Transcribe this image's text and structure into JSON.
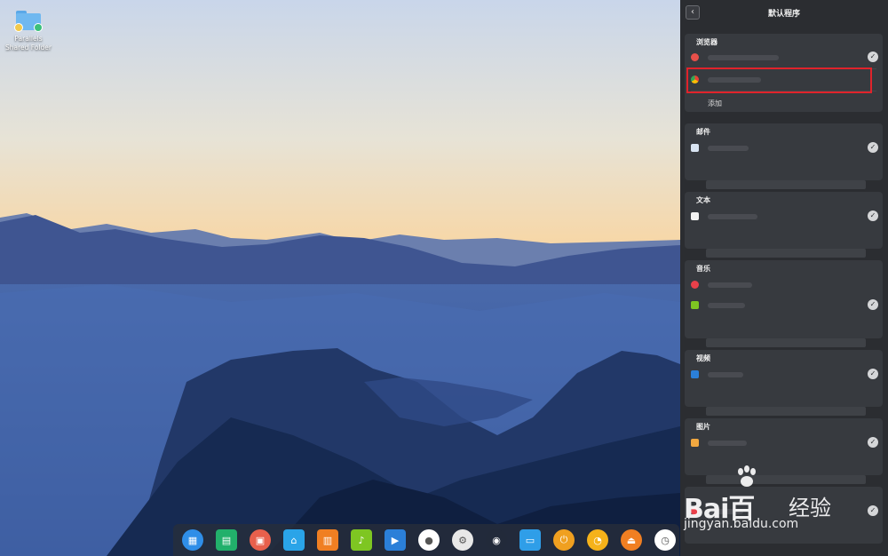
{
  "desktop": {
    "icons": [
      {
        "label": "Parallels Shared Folder",
        "icon": "folder-icon"
      }
    ]
  },
  "panel": {
    "title": "默认程序",
    "back_icon": "chevron-left-icon",
    "sections": [
      {
        "title": "浏览器",
        "add_label": "添加"
      },
      {
        "title": "邮件"
      },
      {
        "title": "文本"
      },
      {
        "title": "音乐"
      },
      {
        "title": "视频"
      },
      {
        "title": "图片"
      },
      {
        "title": ""
      }
    ]
  },
  "dock": {
    "items": [
      {
        "name": "launcher-icon",
        "color": "#2f8ee8"
      },
      {
        "name": "terminal-icon",
        "color": "#22b06b"
      },
      {
        "name": "multitask-icon",
        "color": "#e8604c"
      },
      {
        "name": "store-icon",
        "color": "#2aa4e8"
      },
      {
        "name": "archive-icon",
        "color": "#f07f22"
      },
      {
        "name": "music-icon",
        "color": "#7ec622"
      },
      {
        "name": "video-icon",
        "color": "#2b7fd8"
      },
      {
        "name": "chrome-icon",
        "color": "#ffffff"
      },
      {
        "name": "settings-icon",
        "color": "#e8e8e8"
      },
      {
        "name": "control-center-icon",
        "color": "#222a3a"
      },
      {
        "name": "monitor-icon",
        "color": "#2f9ee8"
      },
      {
        "name": "power-icon",
        "color": "#f0a020"
      },
      {
        "name": "clock-icon",
        "color": "#f5b21a"
      },
      {
        "name": "eject-icon",
        "color": "#f07f22"
      },
      {
        "name": "datetime-icon",
        "color": "#ffffff"
      }
    ]
  },
  "watermark": {
    "brand_text": "Bai",
    "brand_text_2": "百",
    "brand_cn": "经验",
    "url": "jingyan.baidu.com"
  }
}
